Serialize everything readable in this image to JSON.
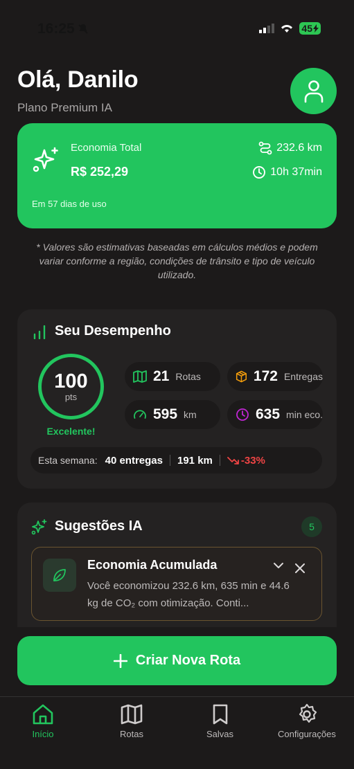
{
  "status_bar": {
    "time": "16:25",
    "battery": "45"
  },
  "header": {
    "greeting": "Olá, Danilo",
    "plan": "Plano Premium IA"
  },
  "economy": {
    "title": "Economia Total",
    "value": "R$ 252,29",
    "distance": "232.6 km",
    "time": "10h 37min",
    "days": "Em 57 dias de uso"
  },
  "disclaimer": "* Valores são estimativas baseadas em cálculos médios e podem variar conforme a região, condições de trânsito e tipo de veículo utilizado.",
  "performance": {
    "title": "Seu Desempenho",
    "score": "100",
    "score_unit": "pts",
    "score_label": "Excelente!",
    "stats": [
      {
        "value": "21",
        "label": "Rotas",
        "icon": "map-icon"
      },
      {
        "value": "172",
        "label": "Entregas",
        "icon": "package-icon"
      },
      {
        "value": "595",
        "label": "km",
        "icon": "gauge-icon"
      },
      {
        "value": "635",
        "label": "min eco.",
        "icon": "clock-icon"
      }
    ],
    "week": {
      "label": "Esta semana:",
      "deliveries": "40 entregas",
      "distance": "191 km",
      "change": "-33%"
    }
  },
  "suggestions": {
    "title": "Sugestões IA",
    "count": "5",
    "item": {
      "title": "Economia Acumulada",
      "text": "Você economizou 232.6 km, 635 min e 44.6 kg de CO₂ com otimização. Conti..."
    }
  },
  "cta": {
    "label": "Criar Nova Rota"
  },
  "tabs": [
    {
      "label": "Início",
      "icon": "home-icon",
      "active": true
    },
    {
      "label": "Rotas",
      "icon": "map-icon",
      "active": false
    },
    {
      "label": "Salvas",
      "icon": "bookmark-icon",
      "active": false
    },
    {
      "label": "Configurações",
      "icon": "gear-icon",
      "active": false
    }
  ],
  "colors": {
    "accent": "#22c55e",
    "background": "#1c1a1a",
    "card": "#242222",
    "orange": "#f59e0b",
    "purple": "#c026d3",
    "negative": "#ef4444"
  }
}
